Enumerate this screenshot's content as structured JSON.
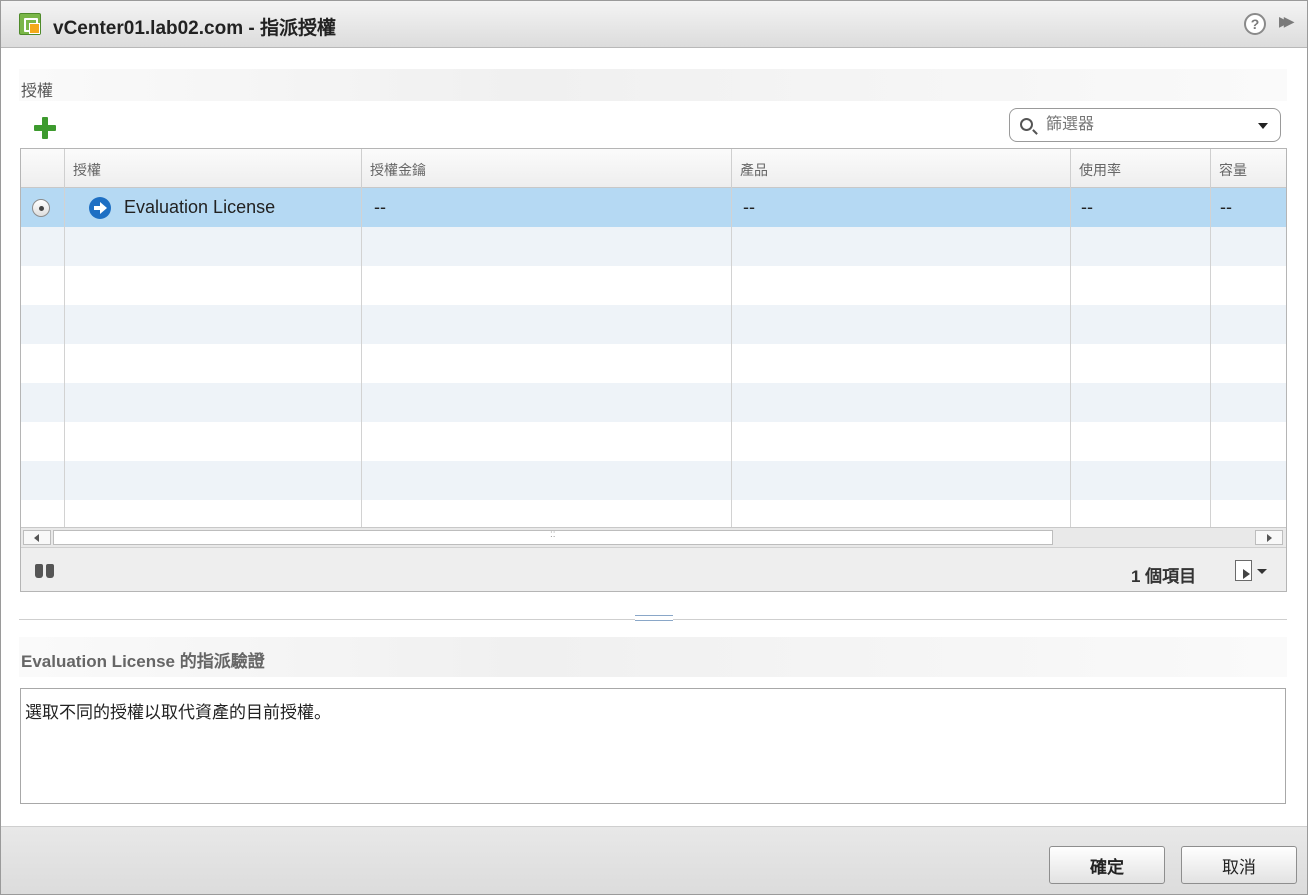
{
  "window": {
    "title": "vCenter01.lab02.com - 指派授權"
  },
  "section": {
    "title": "授權"
  },
  "filter": {
    "placeholder": "篩選器"
  },
  "grid": {
    "columns": [
      "授權",
      "授權金鑰",
      "產品",
      "使用率",
      "容量"
    ],
    "rows": [
      {
        "name": "Evaluation License",
        "key": "--",
        "product": "--",
        "usage": "--",
        "capacity": "--",
        "selected": true
      }
    ],
    "item_count": "1 個項目"
  },
  "detail": {
    "title": "Evaluation License 的指派驗證",
    "message": "選取不同的授權以取代資產的目前授權。"
  },
  "buttons": {
    "ok": "確定",
    "cancel": "取消"
  },
  "icons": [
    "vcenter-license-icon",
    "help-icon",
    "expand-icon",
    "add-icon",
    "search-icon",
    "arrow-right-icon",
    "binoculars-icon",
    "export-icon"
  ],
  "colors": {
    "selected_row": "#b5d9f3",
    "alt_row": "#eef3f8",
    "add_icon": "#3d9a2e",
    "arrow_icon": "#1e6fc3"
  }
}
